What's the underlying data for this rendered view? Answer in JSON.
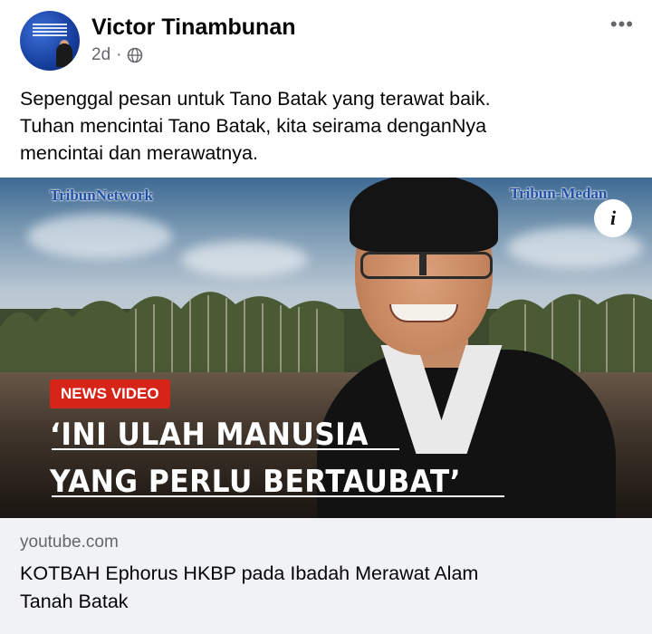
{
  "post": {
    "author": "Victor Tinambunan",
    "time": "2d",
    "audience_icon": "globe-icon",
    "more_icon": "more-options-icon",
    "text_lines": [
      "Sepenggal pesan untuk Tano Batak yang terawat baik.",
      "Tuhan mencintai Tano Batak, kita seirama denganNya",
      "mencintai dan merawatnya."
    ]
  },
  "media": {
    "logo_left": "TribunNetwork",
    "logo_right": "Tribun-Medan",
    "info_icon": "info-icon",
    "badge": "NEWS VIDEO",
    "headline_lines": [
      "‘INI ULAH MANUSIA",
      "YANG PERLU BERTAUBAT’"
    ]
  },
  "link": {
    "domain": "youtube.com",
    "title_lines": [
      "KOTBAH Ephorus HKBP pada Ibadah Merawat Alam",
      "Tanah Batak"
    ]
  },
  "colors": {
    "badge_red": "#d62418",
    "secondary_text": "#65676b",
    "link_background": "#f0f2f5"
  }
}
